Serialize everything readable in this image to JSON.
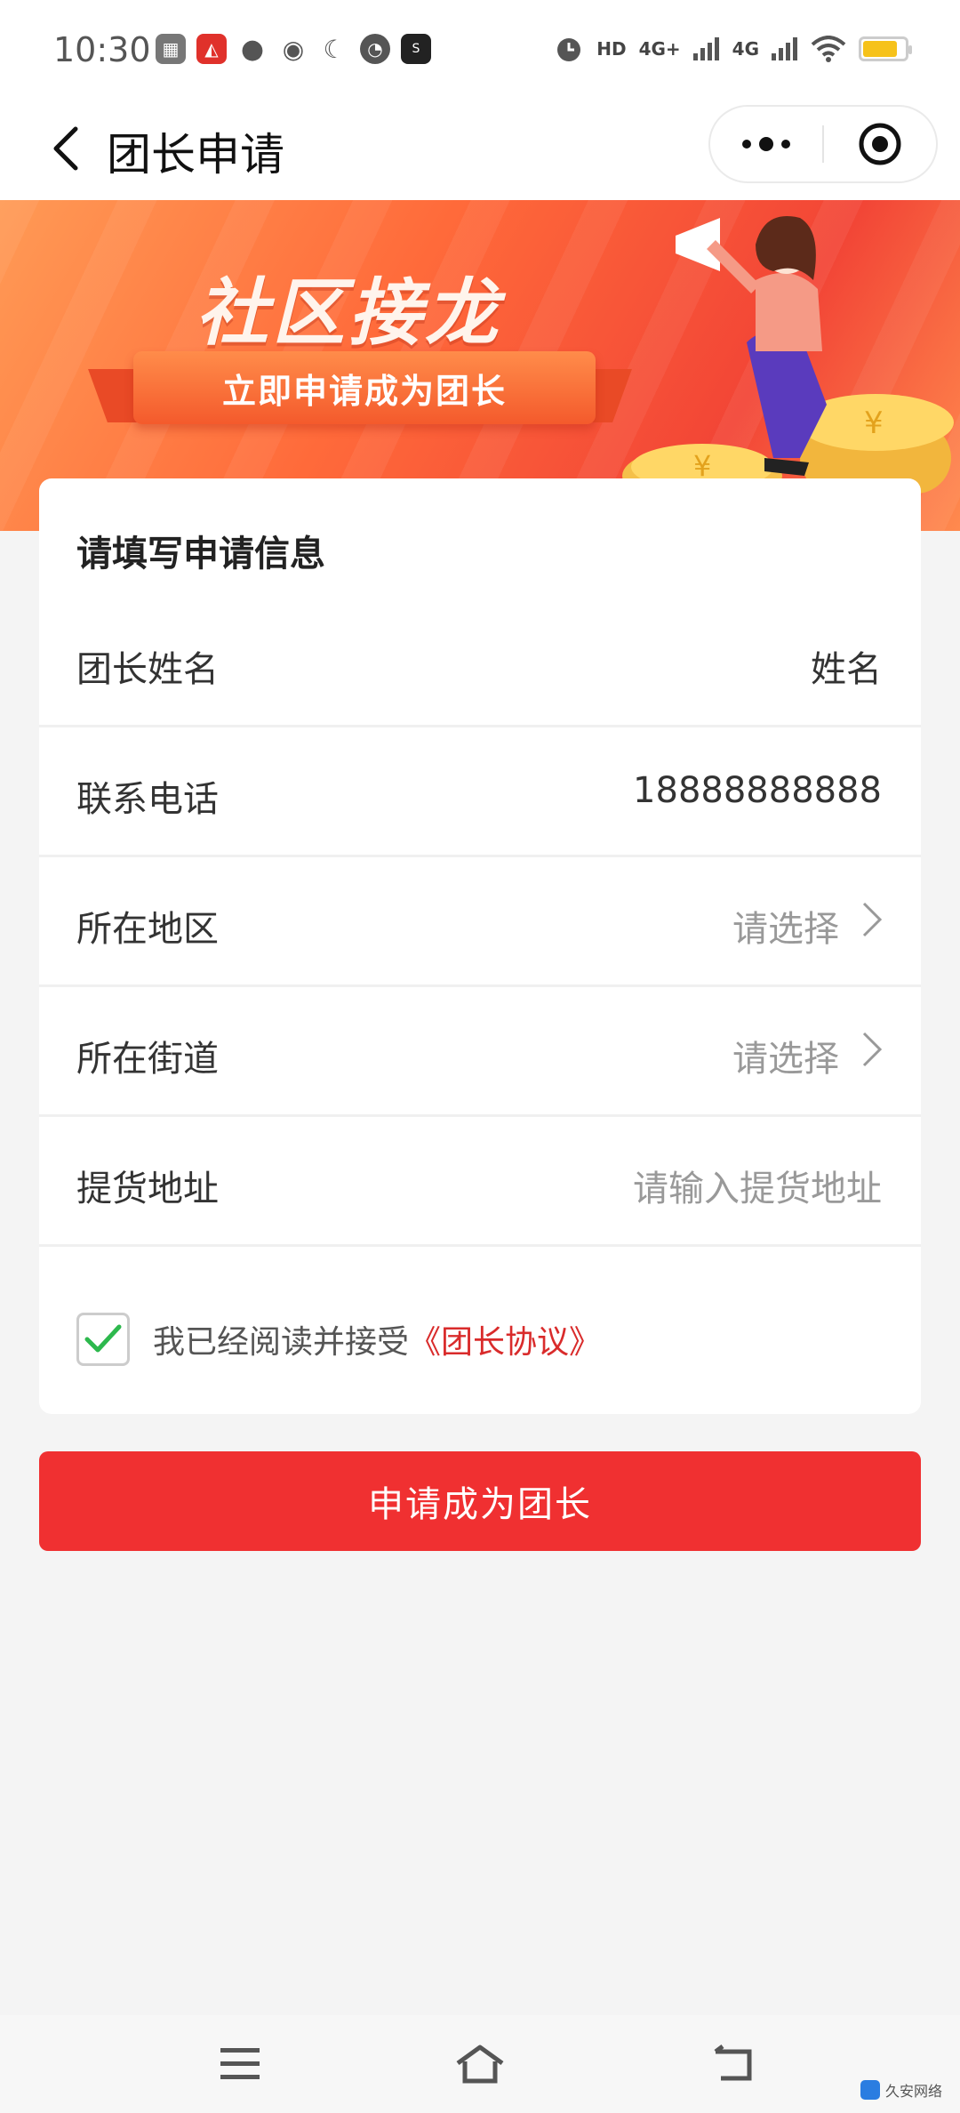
{
  "status_bar": {
    "time": "10:30",
    "indicators": [
      "HD",
      "4G+",
      "4G"
    ],
    "battery_color": "#f6c21a"
  },
  "nav": {
    "title": "团长申请"
  },
  "banner": {
    "title": "社区接龙",
    "subtitle": "立即申请成为团长"
  },
  "form": {
    "section_title": "请填写申请信息",
    "fields": [
      {
        "label": "团长姓名",
        "value": "姓名",
        "placeholder": false,
        "arrow": false
      },
      {
        "label": "联系电话",
        "value": "18888888888",
        "placeholder": false,
        "arrow": false
      },
      {
        "label": "所在地区",
        "value": "请选择",
        "placeholder": true,
        "arrow": true
      },
      {
        "label": "所在街道",
        "value": "请选择",
        "placeholder": true,
        "arrow": true
      },
      {
        "label": "提货地址",
        "value": "请输入提货地址",
        "placeholder": true,
        "arrow": false
      }
    ],
    "agreement_text": "我已经阅读并接受",
    "agreement_link": "《团长协议》",
    "agreement_checked": true,
    "submit_label": "申请成为团长"
  },
  "watermark": {
    "text": "久安网络"
  },
  "colors": {
    "primary": "#f03031",
    "link": "#d92b2b",
    "check": "#2db84d"
  }
}
